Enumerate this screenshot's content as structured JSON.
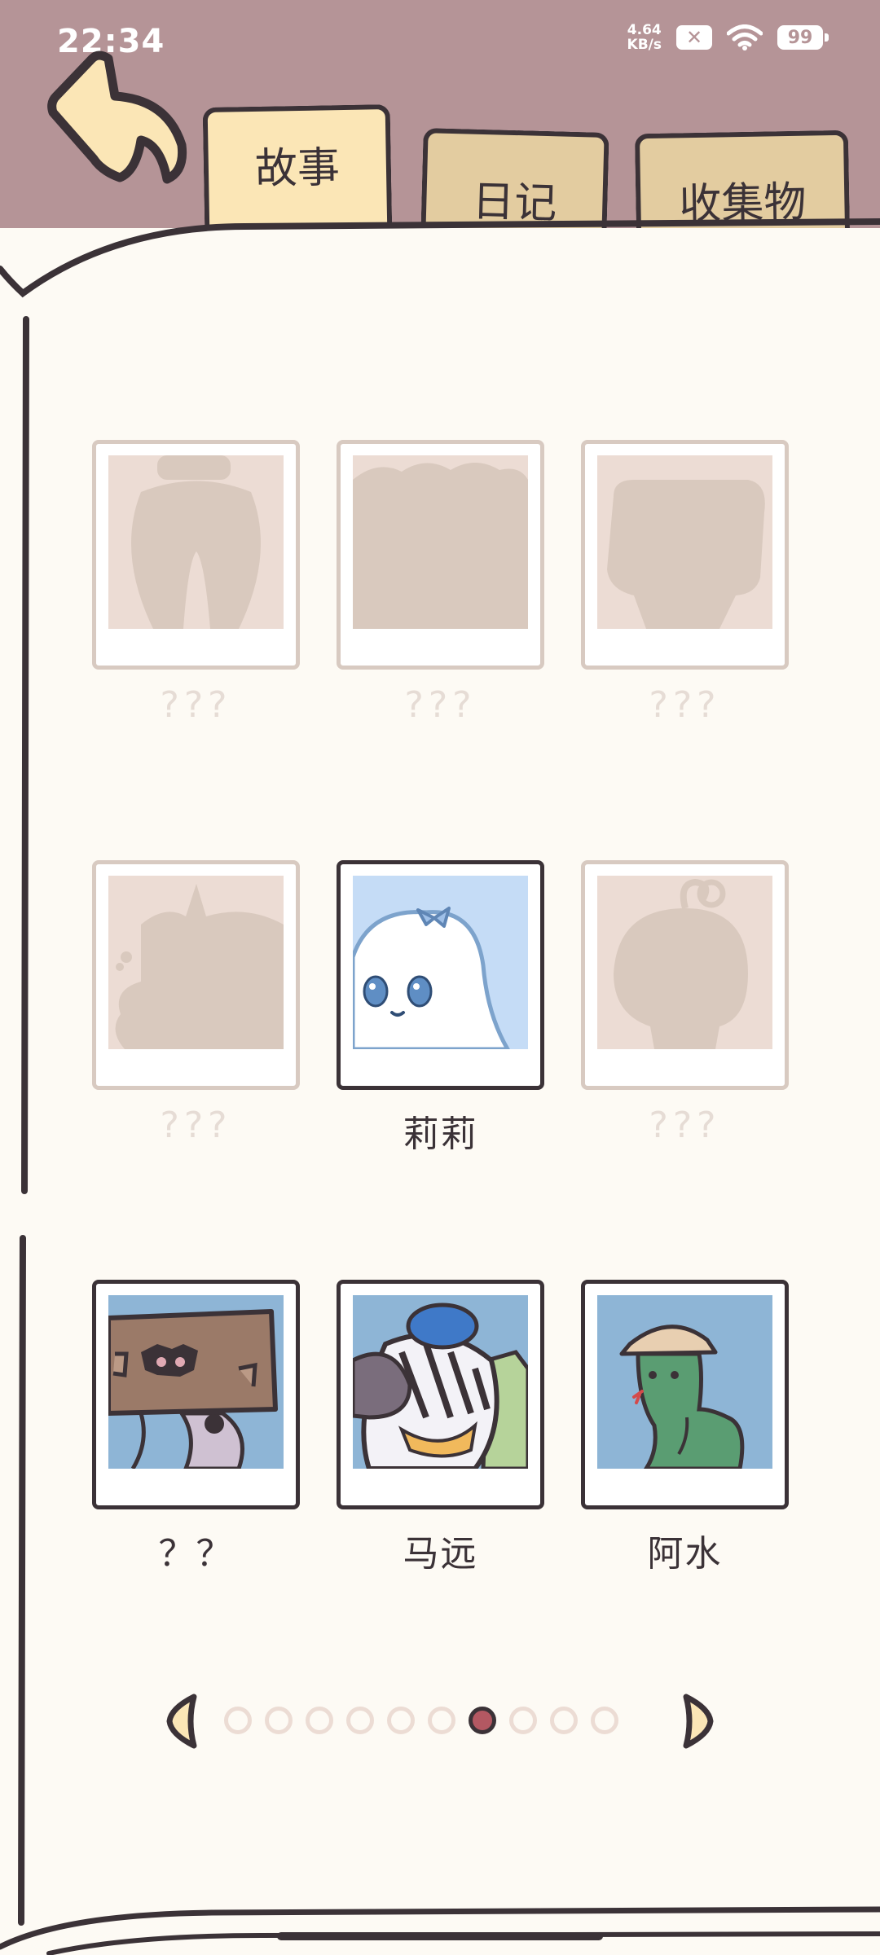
{
  "status_bar": {
    "time": "22:34",
    "net_speed_value": "4.64",
    "net_speed_unit": "KB/s",
    "battery": "99",
    "icons": [
      "close-badge-icon",
      "wifi-icon",
      "battery-icon"
    ]
  },
  "tabs": [
    {
      "label": "故事",
      "active": true
    },
    {
      "label": "日记",
      "active": false
    },
    {
      "label": "收集物",
      "active": false
    }
  ],
  "cards": [
    {
      "name": "???",
      "unlocked": false,
      "silhouette": "vase-figure"
    },
    {
      "name": "???",
      "unlocked": false,
      "silhouette": "cloud-blob"
    },
    {
      "name": "???",
      "unlocked": false,
      "silhouette": "rounded-box-creature"
    },
    {
      "name": "???",
      "unlocked": false,
      "silhouette": "bird-blob"
    },
    {
      "name": "莉莉",
      "unlocked": true,
      "portrait": "ghost-with-bow"
    },
    {
      "name": "???",
      "unlocked": false,
      "silhouette": "round-head-curl"
    },
    {
      "name": "？？",
      "unlocked": true,
      "portrait": "box-head-creature"
    },
    {
      "name": "马远",
      "unlocked": true,
      "portrait": "zebra-with-blue-cap"
    },
    {
      "name": "阿水",
      "unlocked": true,
      "portrait": "green-snake-with-hat"
    }
  ],
  "pagination": {
    "total_pages": 10,
    "current_page": 7
  },
  "colors": {
    "header_bg": "#b59497",
    "page_bg": "#fdfaf4",
    "active_tab": "#fbe6b6",
    "inactive_tab": "#e3cca0",
    "outline": "#3b3237",
    "active_dot": "#b35862",
    "locked_frame": "#d8cac1"
  }
}
